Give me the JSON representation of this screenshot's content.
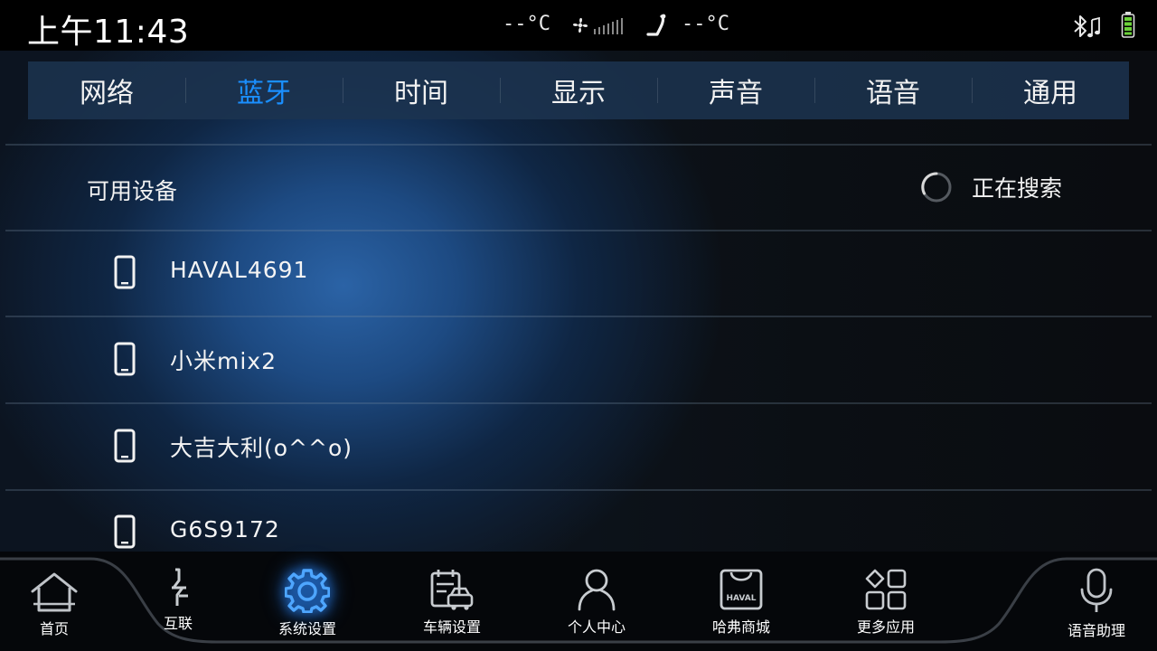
{
  "status": {
    "time": "上午11:43",
    "left_temp": "--°C",
    "right_temp": "--°C"
  },
  "tabs": [
    {
      "label": "网络",
      "active": false
    },
    {
      "label": "蓝牙",
      "active": true
    },
    {
      "label": "时间",
      "active": false
    },
    {
      "label": "显示",
      "active": false
    },
    {
      "label": "声音",
      "active": false
    },
    {
      "label": "语音",
      "active": false
    },
    {
      "label": "通用",
      "active": false
    }
  ],
  "bluetooth": {
    "section_title": "可用设备",
    "search_status": "正在搜索",
    "devices": [
      {
        "name": "HAVAL4691",
        "icon": "phone-icon"
      },
      {
        "name": "小米mix2",
        "icon": "phone-icon"
      },
      {
        "name": "大吉大利(o^^o)",
        "icon": "phone-icon"
      },
      {
        "name": "G6S9172",
        "icon": "phone-icon"
      }
    ]
  },
  "dock": {
    "home": "首页",
    "connect": "互联",
    "system_settings": "系统设置",
    "vehicle_settings": "车辆设置",
    "personal_center": "个人中心",
    "haval_mall": "哈弗商城",
    "haval_logo_text": "HAVAL",
    "more_apps": "更多应用",
    "voice_assistant": "语音助理"
  },
  "colors": {
    "accent": "#1a8fff",
    "tab_bar_bg": "#1c3450"
  }
}
